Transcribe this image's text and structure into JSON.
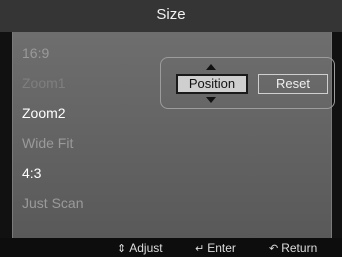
{
  "title": "Size",
  "menu": {
    "items": [
      {
        "label": "16:9",
        "state": "disabled"
      },
      {
        "label": "Zoom1",
        "state": "dim"
      },
      {
        "label": "Zoom2",
        "state": "enabled"
      },
      {
        "label": "Wide Fit",
        "state": "disabled"
      },
      {
        "label": "4:3",
        "state": "enabled"
      },
      {
        "label": "Just Scan",
        "state": "disabled"
      }
    ]
  },
  "submenu": {
    "position_label": "Position",
    "reset_label": "Reset"
  },
  "footer": {
    "adjust": {
      "icon": "updown-icon",
      "glyph": "⇕",
      "label": "Adjust"
    },
    "enter": {
      "icon": "enter-icon",
      "glyph": "↵",
      "label": "Enter"
    },
    "return": {
      "icon": "return-icon",
      "glyph": "↶",
      "label": "Return"
    }
  },
  "colors": {
    "panel": "#636363",
    "title_bar": "#353535",
    "footer": "#0d0d0d",
    "selected_button": "#cfcfcf"
  }
}
